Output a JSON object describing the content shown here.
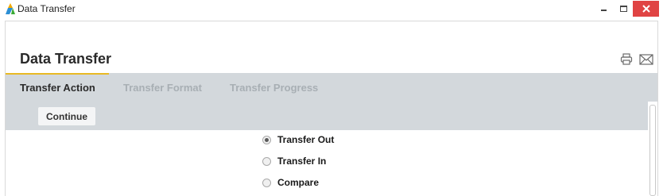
{
  "window": {
    "title": "Data Transfer",
    "close_glyph": "✕"
  },
  "page": {
    "title": "Data Transfer",
    "icons": [
      "print-icon",
      "mail-icon"
    ]
  },
  "tabs": [
    {
      "label": "Transfer Action",
      "state": "active"
    },
    {
      "label": "Transfer Format",
      "state": "inactive"
    },
    {
      "label": "Transfer Progress",
      "state": "inactive"
    }
  ],
  "toolbar": {
    "continue_label": "Continue"
  },
  "options": [
    {
      "label": "Transfer Out",
      "checked": true
    },
    {
      "label": "Transfer In",
      "checked": false
    },
    {
      "label": "Compare",
      "checked": false
    }
  ],
  "colors": {
    "tab_accent": "#e8b923",
    "tabbar_bg": "#d3d8dc",
    "close_button": "#e04343"
  }
}
